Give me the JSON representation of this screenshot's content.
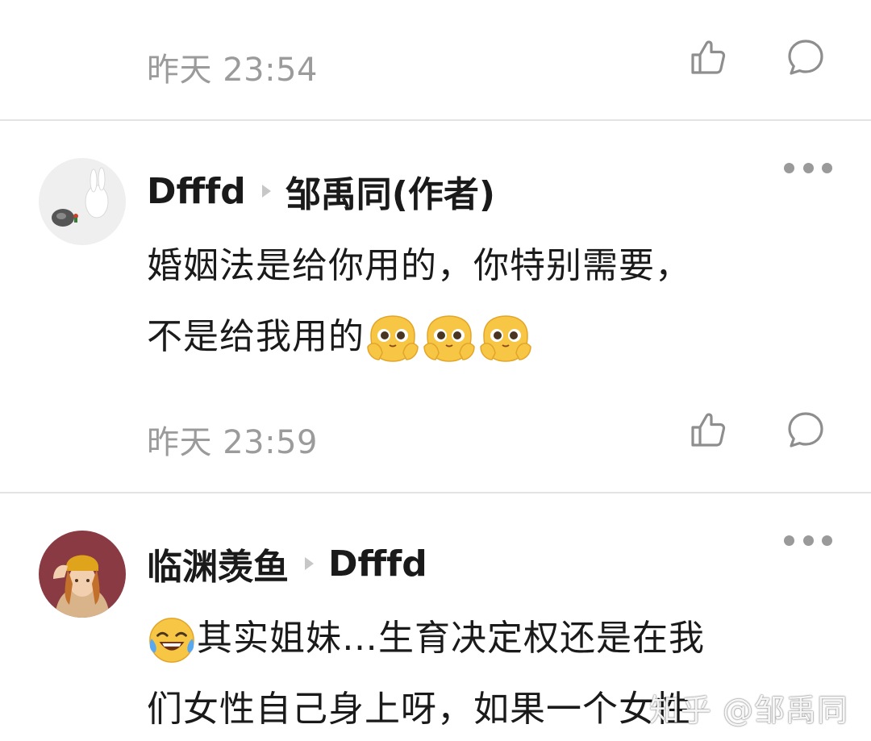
{
  "previous_comment": {
    "time": "昨天 23:54"
  },
  "comments": [
    {
      "author": "Dfffd",
      "reply_to": "邹禹同(作者)",
      "line1": "婚姻法是给你用的，你特别需要，",
      "line2_text": "不是给我用的",
      "line2_emojis": [
        "shy-hands-emoji",
        "shy-hands-emoji",
        "shy-hands-emoji"
      ],
      "time": "昨天 23:59"
    },
    {
      "author": "临渊羡鱼",
      "reply_to": "Dfffd",
      "line1_emoji": "laughing-crying-emoji",
      "line1": "其实姐妹…生育决定权还是在我",
      "line2": "们女性自己身上呀，如果一个女性"
    }
  ],
  "icons": {
    "like": "thumbs-up-icon",
    "reply": "comment-bubble-icon",
    "more": "more-dots-icon"
  },
  "watermark": "知乎 @邹禹同",
  "colors": {
    "text": "#1a1a1a",
    "meta": "#9b9b9b",
    "divider": "#e3e3e3"
  }
}
